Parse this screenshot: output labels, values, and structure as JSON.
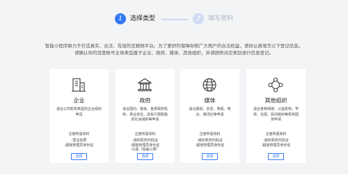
{
  "stepper": {
    "step1": {
      "number": "1",
      "label": "选择类型"
    },
    "step2": {
      "number": "2",
      "label": "填写资料"
    }
  },
  "intro": {
    "line1": "智能小程序致力于打造真实、合法、有效的互联网平台。为了更好的保障你和广大用户的合法权益，请你认真填写以下登记信息。",
    "line2": "请确认你的百度帐号主体类型属于企业、政府、媒体、其他组织，并请按照对应类别进行信息登记。"
  },
  "cards": [
    {
      "icon": "building-icon",
      "title": "企业",
      "desc": [
        "适合公司机构类型的企业组织申请"
      ],
      "docs_title": "注册所需资料",
      "docs": [
        "-营业执照",
        "-超级管理员身份证"
      ],
      "button": "选择"
    },
    {
      "icon": "government-icon",
      "title": "政府",
      "desc": [
        "适合国内、各级、各类政府机构、事业单位、具有行政职能的社会组织等申请"
      ],
      "docs_title": "注册所需资料",
      "docs": [
        "-组织机构代码证",
        "-超级管理员身份证",
        "-公函（加盖公章）"
      ],
      "button": "选择"
    },
    {
      "icon": "media-icon",
      "title": "媒体",
      "desc": [
        "适合报纸、杂志、电视、电台、通讯社等申请"
      ],
      "docs_title": "注册所需资料",
      "docs": [
        "-组织机构代码证",
        "-超级管理员身份证"
      ],
      "button": "选择"
    },
    {
      "icon": "organization-icon",
      "title": "其他组织",
      "desc": [
        "适合各种场馆、公益机构、学校、社团、民间组织等机构团体申请"
      ],
      "docs_title": "注册所需资料",
      "docs": [
        "-组织机构代码证",
        "-超级管理员身份证"
      ],
      "button": "选择"
    }
  ],
  "colors": {
    "accent": "#3478f6",
    "inactive_step": "#cfdcf1",
    "background": "#f3f4f6"
  }
}
